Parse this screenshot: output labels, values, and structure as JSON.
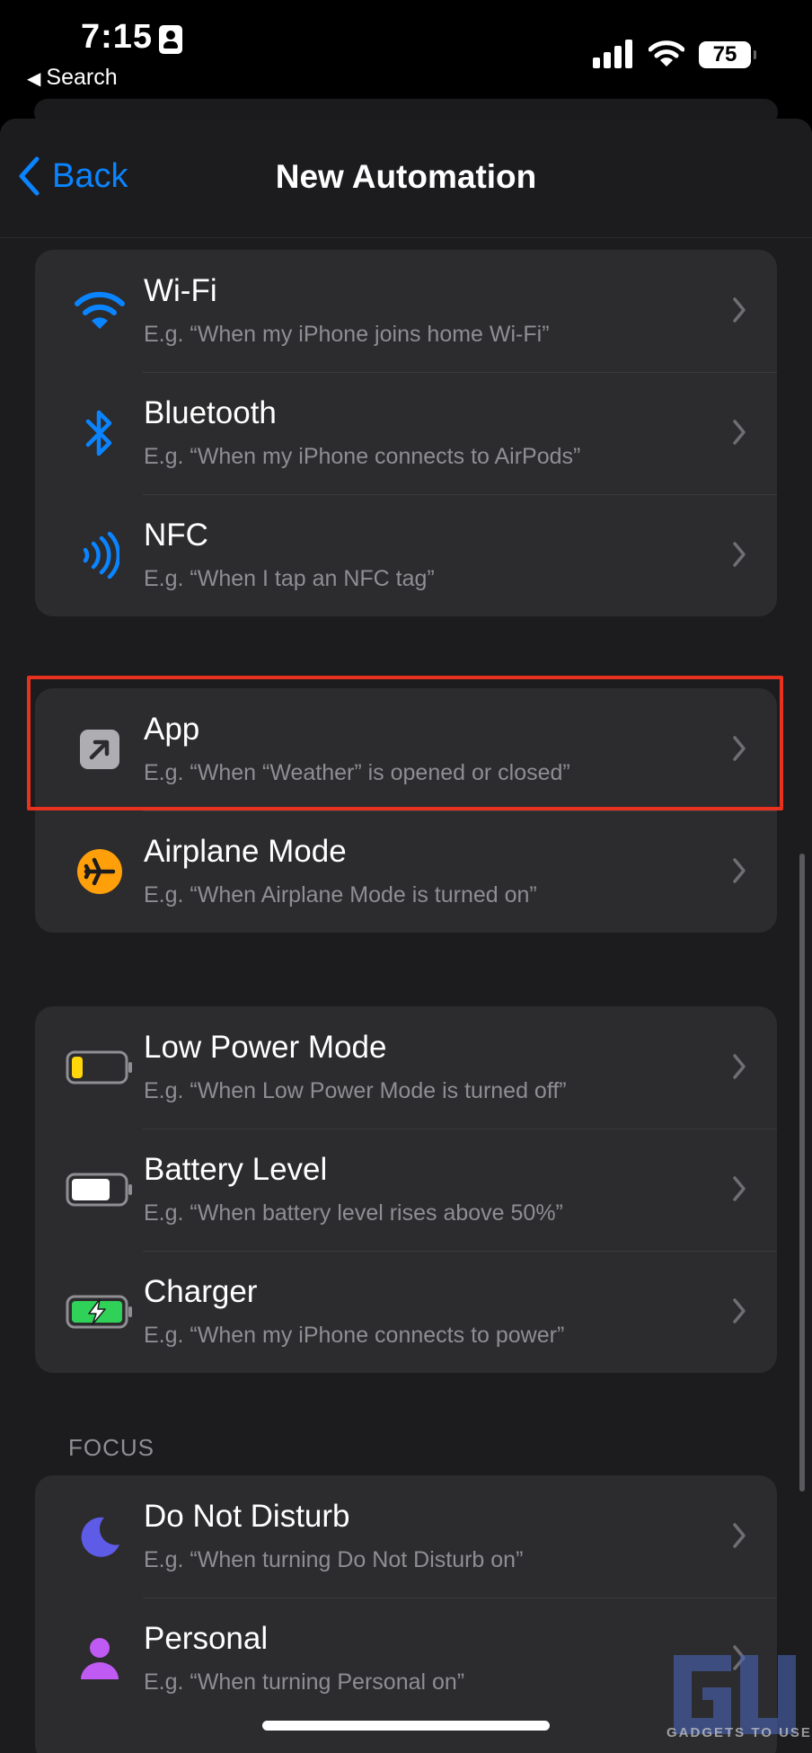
{
  "status_bar": {
    "time": "7:15",
    "back_app": "Search",
    "battery_level": "75"
  },
  "nav": {
    "back_label": "Back",
    "title": "New Automation"
  },
  "colors": {
    "accent": "#0a84ff",
    "highlight": "#e8311e",
    "airplane": "#ff9f0a",
    "low_power": "#ffd60a",
    "charger": "#30d158",
    "focus_moon": "#5e5ce6",
    "focus_person": "#bf5af2"
  },
  "groups": [
    [
      {
        "icon": "wifi-icon",
        "title": "Wi-Fi",
        "subtitle": "E.g. “When my iPhone joins home Wi-Fi”"
      },
      {
        "icon": "bluetooth-icon",
        "title": "Bluetooth",
        "subtitle": "E.g. “When my iPhone connects to AirPods”"
      },
      {
        "icon": "nfc-icon",
        "title": "NFC",
        "subtitle": "E.g. “When I tap an NFC tag”"
      }
    ],
    [
      {
        "icon": "app-arrow-icon",
        "title": "App",
        "subtitle": "E.g. “When “Weather” is opened or closed”"
      },
      {
        "icon": "airplane-icon",
        "title": "Airplane Mode",
        "subtitle": "E.g. “When Airplane Mode is turned on”"
      }
    ],
    [
      {
        "icon": "low-power-battery-icon",
        "title": "Low Power Mode",
        "subtitle": "E.g. “When Low Power Mode is turned off”"
      },
      {
        "icon": "battery-level-icon",
        "title": "Battery Level",
        "subtitle": "E.g. “When battery level rises above 50%”"
      },
      {
        "icon": "charger-icon",
        "title": "Charger",
        "subtitle": "E.g. “When my iPhone connects to power”"
      }
    ],
    [
      {
        "icon": "moon-icon",
        "title": "Do Not Disturb",
        "subtitle": "E.g. “When turning Do Not Disturb on”"
      },
      {
        "icon": "person-icon",
        "title": "Personal",
        "subtitle": "E.g. “When turning Personal on”"
      }
    ]
  ],
  "focus_section_label": "FOCUS",
  "watermark": "GADGETS TO USE"
}
